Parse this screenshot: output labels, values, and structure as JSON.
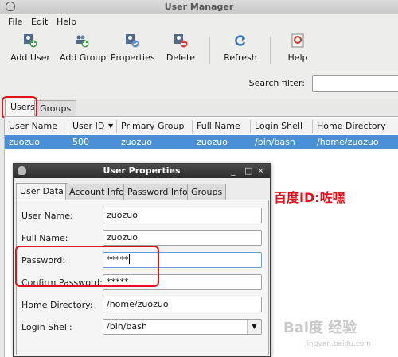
{
  "window": {
    "title": "User Manager"
  },
  "menu": [
    "File",
    "Edit",
    "Help"
  ],
  "toolbar": {
    "add_user": "Add User",
    "add_group": "Add Group",
    "properties": "Properties",
    "delete": "Delete",
    "refresh": "Refresh",
    "help": "Help"
  },
  "search": {
    "label": "Search filter:",
    "value": ""
  },
  "tabs": {
    "users": "Users",
    "groups": "Groups"
  },
  "table": {
    "columns": [
      "User Name",
      "User ID",
      "Primary Group",
      "Full Name",
      "Login Shell",
      "Home Directory"
    ],
    "sort_indicator": "▼",
    "rows": [
      {
        "user_name": "zuozuo",
        "user_id": "500",
        "primary_group": "zuozuo",
        "full_name": "zuozuo",
        "login_shell": "/bin/bash",
        "home_directory": "/home/zuozuo"
      }
    ]
  },
  "dialog": {
    "title": "User Properties",
    "tabs": [
      "User Data",
      "Account Info",
      "Password Info",
      "Groups"
    ],
    "fields": {
      "user_name": {
        "label": "User Name:",
        "value": "zuozuo"
      },
      "full_name": {
        "label": "Full Name:",
        "value": "zuozuo"
      },
      "password": {
        "label": "Password:",
        "value": "*****"
      },
      "confirm_password": {
        "label": "Confirm Password:",
        "value": "*****"
      },
      "home_directory": {
        "label": "Home Directory:",
        "value": "/home/zuozuo"
      },
      "login_shell": {
        "label": "Login Shell:",
        "value": "/bin/bash"
      }
    }
  },
  "annotation": "百度ID:咗嘿",
  "watermark": {
    "text": "Bai度 经验",
    "url": "jingyan.baidu.com"
  },
  "colors": {
    "highlight": "#e1121b",
    "selection": "#4a90d9"
  }
}
